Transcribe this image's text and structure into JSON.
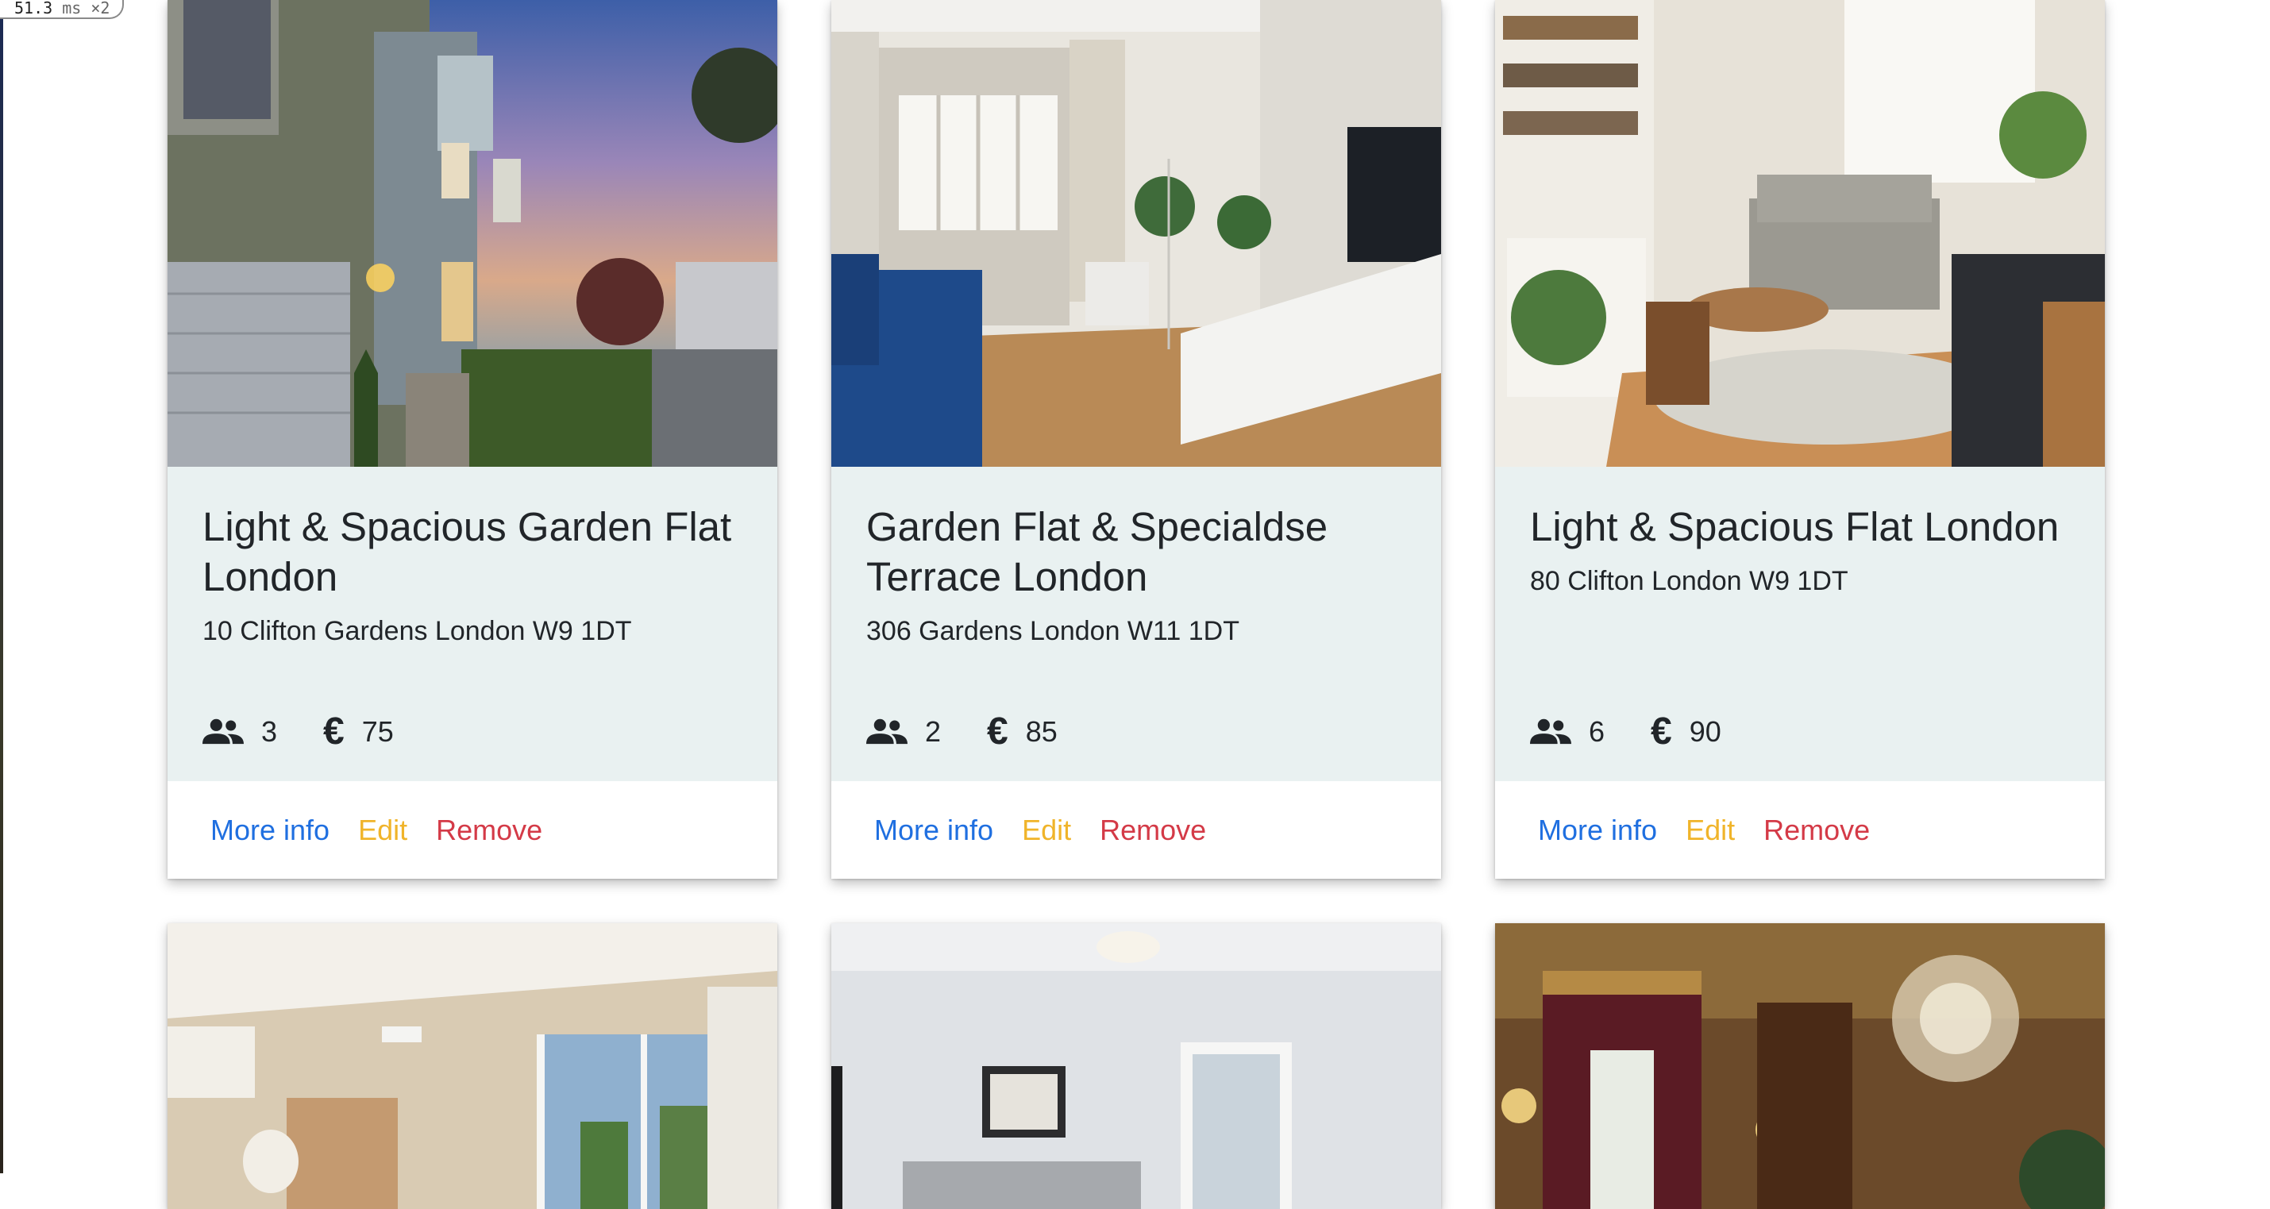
{
  "fps_counter": {
    "value": "51.3",
    "unit": "ms ×2"
  },
  "listings": [
    {
      "title": "Light & Spacious Garden Flat London",
      "address": "10 Clifton Gardens London W9 1DT",
      "guests": "3",
      "price": "75",
      "currency_icon": "euro-icon",
      "guests_icon": "people-icon",
      "actions": {
        "more_info": "More info",
        "edit": "Edit",
        "remove": "Remove"
      }
    },
    {
      "title": "Garden Flat & Specialdse Terrace London",
      "address": "306 Gardens London W11 1DT",
      "guests": "2",
      "price": "85",
      "currency_icon": "euro-icon",
      "guests_icon": "people-icon",
      "actions": {
        "more_info": "More info",
        "edit": "Edit",
        "remove": "Remove"
      }
    },
    {
      "title": "Light & Spacious Flat London",
      "address": "80 Clifton London W9 1DT",
      "guests": "6",
      "price": "90",
      "currency_icon": "euro-icon",
      "guests_icon": "people-icon",
      "actions": {
        "more_info": "More info",
        "edit": "Edit",
        "remove": "Remove"
      }
    }
  ],
  "colors": {
    "card_body_bg": "#e9f1f1",
    "more_info": "#1f6fe0",
    "edit": "#f0b42a",
    "remove": "#d43a47",
    "text": "#212529"
  }
}
